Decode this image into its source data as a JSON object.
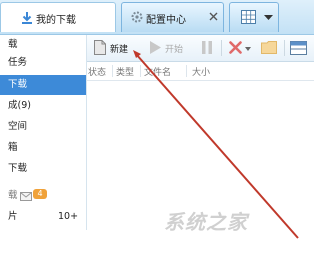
{
  "tabs": {
    "download": {
      "label": "我的下载",
      "icon": "download-icon"
    },
    "config": {
      "label": "配置中心",
      "icon": "gear-icon",
      "close_icon": "close-icon"
    },
    "grid": {
      "icon": "grid-icon",
      "dropdown_icon": "chevron-down-icon"
    }
  },
  "sidebar": {
    "items": [
      {
        "label": "载"
      },
      {
        "label": "任务"
      },
      {
        "label": "下载"
      },
      {
        "label": "成(9)"
      },
      {
        "label": "空间"
      },
      {
        "label": "箱"
      },
      {
        "label": "下载"
      },
      {
        "label": "载"
      },
      {
        "label": "片"
      }
    ],
    "badge": "4",
    "count": "10+"
  },
  "toolbar": {
    "new_label": "新建",
    "start_label": "开始",
    "icons": [
      "new-file-icon",
      "play-icon",
      "pause-icon",
      "delete-icon",
      "folder-icon",
      "panel-icon"
    ]
  },
  "columns": [
    "状态",
    "类型",
    "文件名",
    "大小"
  ],
  "watermark": "系统之家",
  "colors": {
    "annotation_arrow": "#c0392b",
    "selected": "#3d8ad8"
  }
}
